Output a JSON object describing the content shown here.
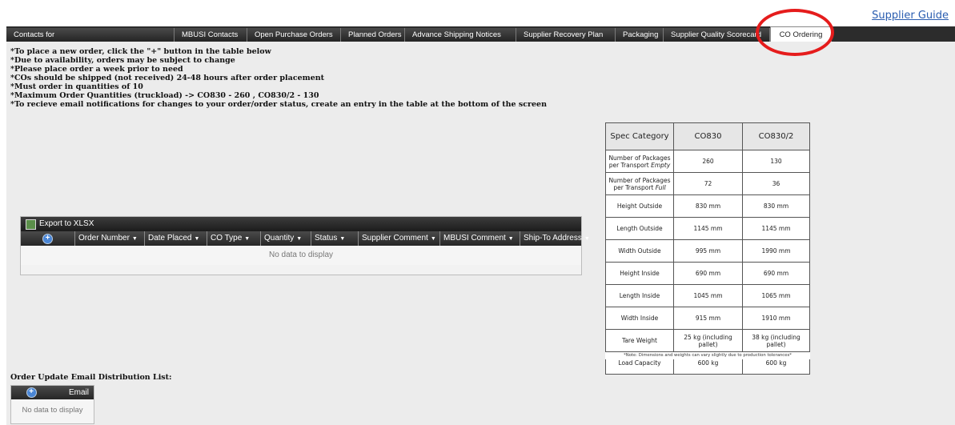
{
  "header": {
    "supplier_guide": "Supplier Guide"
  },
  "tabs": [
    {
      "label": "Contacts for",
      "width": 210
    },
    {
      "label": "MBUSI Contacts",
      "width": 91
    },
    {
      "label": "Open Purchase Orders",
      "width": 117
    },
    {
      "label": "Planned Orders",
      "width": 80
    },
    {
      "label": "Advance Shipping Notices",
      "width": 139
    },
    {
      "label": "Supplier Recovery Plan",
      "width": 124
    },
    {
      "label": "Packaging",
      "width": 60
    },
    {
      "label": "Supplier Quality Scorecard",
      "width": 133
    },
    {
      "label": "CO Ordering",
      "width": 77,
      "active": true
    }
  ],
  "instructions": [
    "*To place a new order, click the \"+\" button in the table below",
    "*Due to availability, orders may be subject to change",
    "*Please place order a week prior to need",
    "*COs should be shipped (not received) 24-48 hours after order placement",
    "*Must order in quantities of 10",
    "*Maximum Order Quantities (truckload) -> CO830 - 260 , CO830/2 - 130",
    "*To recieve email notifications for changes to your order/order status, create an entry in the table at the bottom of the screen"
  ],
  "orders_grid": {
    "export_label": "Export to XLSX",
    "columns": [
      "Order Number",
      "Date Placed",
      "CO Type",
      "Quantity",
      "Status",
      "Supplier Comment",
      "MBUSI Comment",
      "Ship-To Address"
    ],
    "empty_text": "No data to display"
  },
  "spec_table": {
    "headers": [
      "Spec Category",
      "CO830",
      "CO830/2"
    ],
    "rows": [
      {
        "label": "Number of Packages per Transport",
        "label_em": "Empty",
        "co830": "260",
        "co830_2": "130"
      },
      {
        "label": "Number of Packages per Transport",
        "label_em": "Full",
        "co830": "72",
        "co830_2": "36"
      },
      {
        "label": "Height Outside",
        "co830": "830 mm",
        "co830_2": "830 mm"
      },
      {
        "label": "Length Outside",
        "co830": "1145 mm",
        "co830_2": "1145 mm"
      },
      {
        "label": "Width Outside",
        "co830": "995 mm",
        "co830_2": "1990 mm"
      },
      {
        "label": "Height Inside",
        "co830": "690 mm",
        "co830_2": "690 mm"
      },
      {
        "label": "Length Inside",
        "co830": "1045 mm",
        "co830_2": "1065 mm"
      },
      {
        "label": "Width Inside",
        "co830": "915 mm",
        "co830_2": "1910 mm"
      },
      {
        "label": "Tare Weight",
        "co830": "25 kg (including pallet)",
        "co830_2": "38 kg (including pallet)"
      },
      {
        "label": "Load Capacity",
        "co830": "600 kg",
        "co830_2": "600 kg"
      }
    ],
    "note": "*Note: Dimensions and weights can vary slightly due to production tolerances*"
  },
  "email_list": {
    "heading": "Order Update Email Distribution List:",
    "column": "Email",
    "empty_text": "No data to display"
  },
  "colors": {
    "highlight": "#e51c1c",
    "link": "#2a5db0"
  }
}
